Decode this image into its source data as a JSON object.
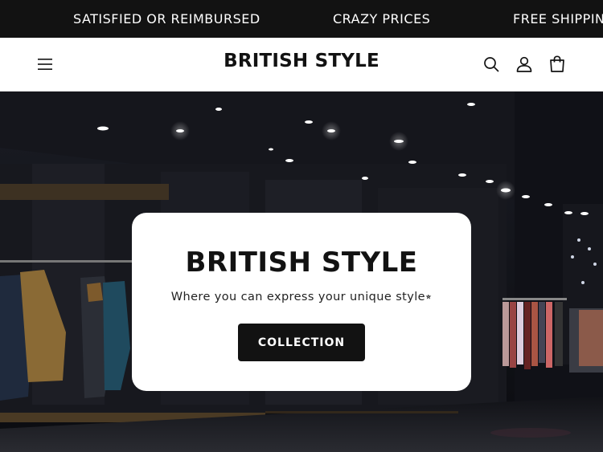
{
  "announcement": {
    "messages": [
      "SATISFIED OR REIMBURSED",
      "CRAZY PRICES",
      "FREE SHIPPING"
    ]
  },
  "header": {
    "logo": "BRITISH STYLE",
    "icons": [
      "menu-icon",
      "search-icon",
      "account-icon",
      "cart-icon"
    ]
  },
  "hero": {
    "title": "BRITISH STYLE",
    "subtitle": "Where you can express your unique style⭒",
    "button_label": "COLLECTION"
  },
  "colors": {
    "dark": "#121212",
    "white": "#ffffff"
  }
}
